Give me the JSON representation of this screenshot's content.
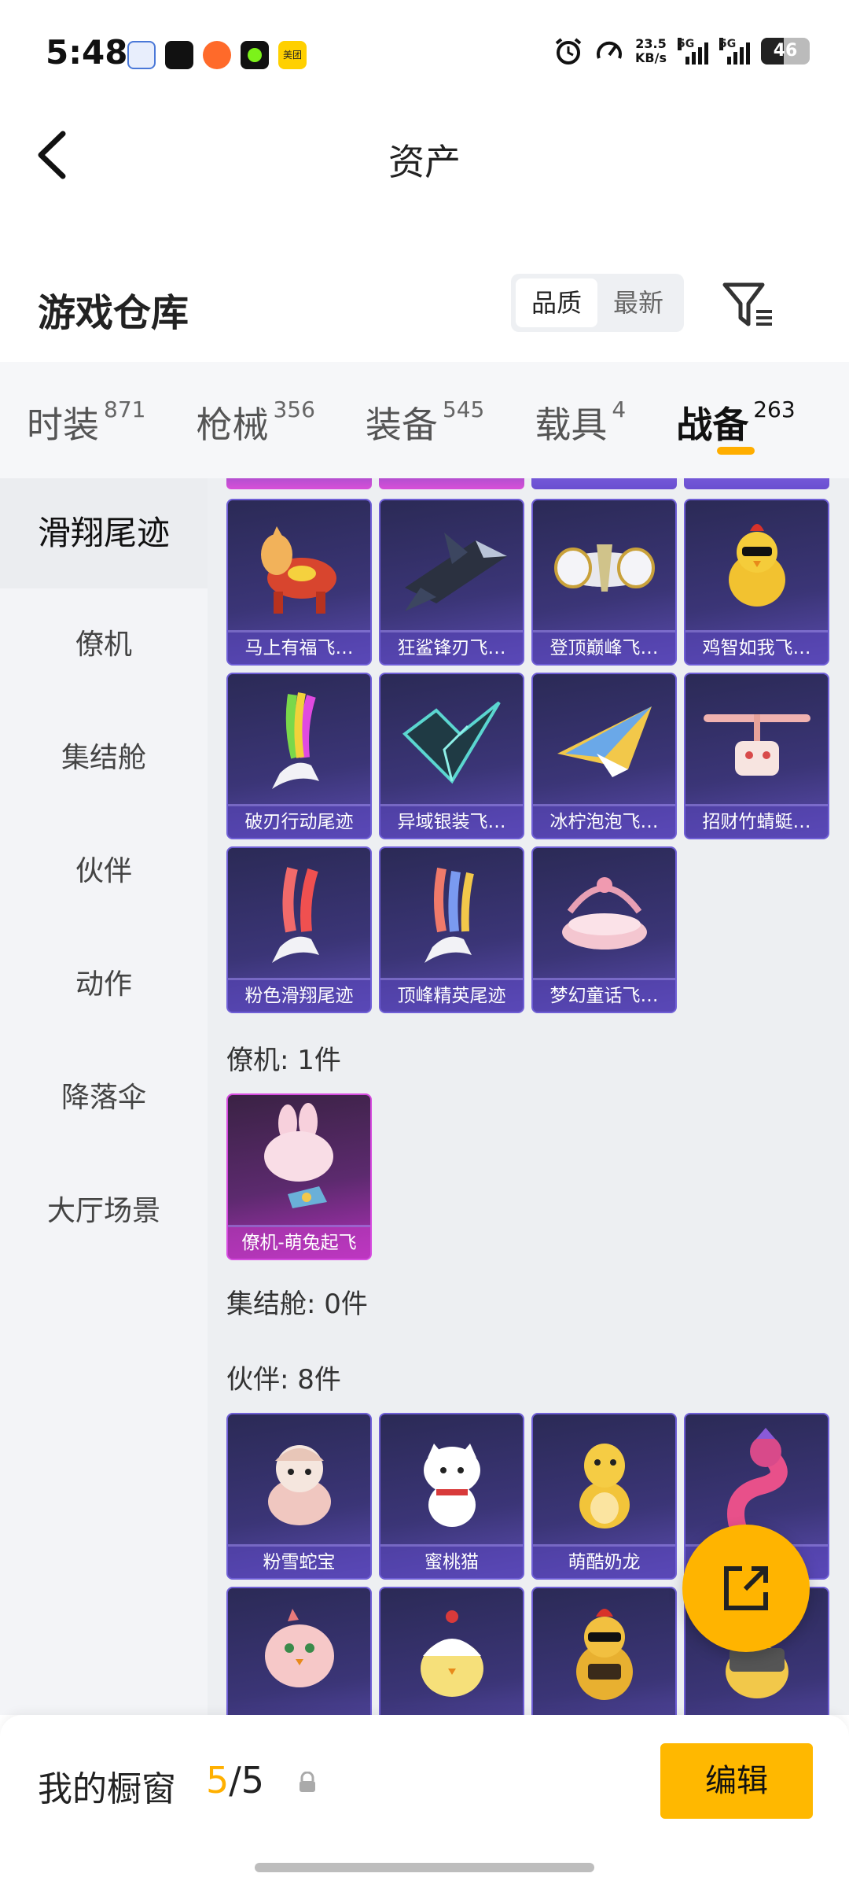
{
  "status_bar": {
    "time": "5:48",
    "net_speed": "23.5",
    "net_unit": "KB/s",
    "sim1": "5G",
    "sim2": "5G",
    "battery": "46",
    "meituan": "美团"
  },
  "header": {
    "title": "资产"
  },
  "warehouse": {
    "title": "游戏仓库",
    "sort_options": [
      "品质",
      "最新"
    ],
    "sort_selected": "品质"
  },
  "tabs": [
    {
      "label": "时装",
      "count": "871"
    },
    {
      "label": "枪械",
      "count": "356"
    },
    {
      "label": "装备",
      "count": "545"
    },
    {
      "label": "载具",
      "count": "4"
    },
    {
      "label": "战备",
      "count": "263"
    }
  ],
  "active_tab": "战备",
  "sidebar": {
    "items": [
      "滑翔尾迹",
      "僚机",
      "集结舱",
      "伙伴",
      "动作",
      "降落伞",
      "大厅场景"
    ],
    "active": "滑翔尾迹"
  },
  "glide_trail_items": [
    {
      "label": "马上有福飞…",
      "icon": "horse-glider"
    },
    {
      "label": "狂鲨锋刃飞…",
      "icon": "shark-glider"
    },
    {
      "label": "登顶巅峰飞…",
      "icon": "jet-glider"
    },
    {
      "label": "鸡智如我飞…",
      "icon": "chicken-glider"
    },
    {
      "label": "破刃行动尾迹",
      "icon": "rainbow-trail"
    },
    {
      "label": "异域银装飞…",
      "icon": "wing-glider"
    },
    {
      "label": "冰柠泡泡飞…",
      "icon": "plane-glider"
    },
    {
      "label": "招财竹蜻蜓…",
      "icon": "copter-glider"
    },
    {
      "label": "粉色滑翔尾迹",
      "icon": "pink-trail"
    },
    {
      "label": "顶峰精英尾迹",
      "icon": "elite-trail"
    },
    {
      "label": "梦幻童话飞…",
      "icon": "fairytale-glider"
    }
  ],
  "wingman_section": {
    "title": "僚机: 1件"
  },
  "wingman_items": [
    {
      "label": "僚机-萌兔起飞",
      "icon": "bunny-wingman"
    }
  ],
  "rally_section": {
    "title": "集结舱: 0件"
  },
  "partner_section": {
    "title": "伙伴: 8件"
  },
  "partner_items": [
    {
      "label": "粉雪蛇宝",
      "icon": "snake-partner"
    },
    {
      "label": "蜜桃猫",
      "icon": "cat-partner"
    },
    {
      "label": "萌酷奶龙",
      "icon": "dragon-partner"
    },
    {
      "label": "",
      "icon": "pink-snake-partner"
    },
    {
      "label": "",
      "icon": "pink-bird-partner"
    },
    {
      "label": "",
      "icon": "chick-partner"
    },
    {
      "label": "",
      "icon": "rooster-partner"
    },
    {
      "label": "",
      "icon": "duck-partner"
    }
  ],
  "showcase": {
    "label": "我的橱窗",
    "current": "5",
    "separator": "/",
    "total": "5",
    "edit_label": "编辑"
  },
  "colors": {
    "accent": "#ffb400",
    "card_purple": "#3b3577",
    "card_pink": "#b030b8"
  }
}
